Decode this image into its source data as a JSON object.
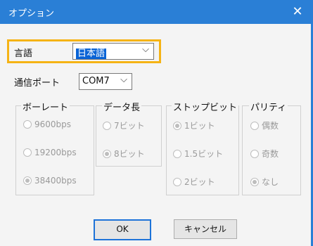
{
  "window": {
    "title": "オプション"
  },
  "language": {
    "label": "言語",
    "value": "日本語"
  },
  "port": {
    "label": "通信ポート",
    "value": "COM7"
  },
  "groups": {
    "baud": {
      "title": "ボーレート",
      "options": [
        "9600bps",
        "19200bps",
        "38400bps"
      ],
      "selected": "38400bps"
    },
    "data": {
      "title": "データ長",
      "options": [
        "7ビット",
        "8ビット"
      ],
      "selected": "8ビット"
    },
    "stop": {
      "title": "ストップビット",
      "options": [
        "1ビット",
        "1.5ビット",
        "2ビット"
      ],
      "selected": "1ビット"
    },
    "parity": {
      "title": "パリティ",
      "options": [
        "偶数",
        "奇数",
        "なし"
      ],
      "selected": "なし"
    }
  },
  "buttons": {
    "ok": "OK",
    "cancel": "キャンセル"
  },
  "colors": {
    "titlebar": "#2a7fd6",
    "highlight": "#f5b315",
    "selection": "#0a64d6"
  }
}
